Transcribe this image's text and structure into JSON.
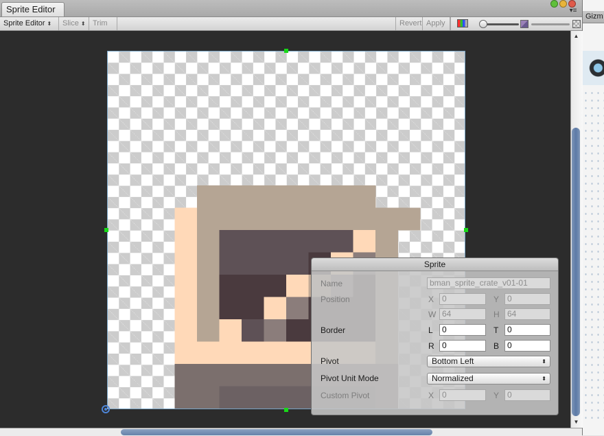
{
  "window": {
    "tab_title": "Sprite Editor",
    "buttons": [
      "close",
      "minimize",
      "zoom"
    ]
  },
  "right_panel": {
    "tab_label": "Gizm"
  },
  "toolbar": {
    "editor_dropdown": "Sprite Editor",
    "slice": "Slice",
    "trim": "Trim",
    "revert": "Revert",
    "apply": "Apply",
    "color_icon": "rgb-channel-icon",
    "zoom_level": 0.2
  },
  "colors": {
    "handle": "#18d818",
    "pivot": "#4e86d8",
    "viewport_bg": "#2c2c2c",
    "scroll_thumb": "#5c7aa6"
  },
  "sprite_image": {
    "grid": 16,
    "palette": {
      "A": "#ffd9b8",
      "B": "#b5a594",
      "C": "#9c8e81",
      "D": "#7b6f6d",
      "E": "#5e5156",
      "F": "#4a3a3e",
      "G": "#8b7d7b",
      "H": "#c1aa96",
      "I": "#a39083",
      "J": "#6c6163"
    },
    "rows": [
      "................",
      "................",
      "................",
      "................",
      "................",
      "..........",
      "....BBBBBBBB....",
      "...ABBBBBBBBBB..",
      "...ABEEEEEEAB...",
      "...ABEEEEFAGB...",
      "...ABFFFAHGFB...",
      "...ABFFAGFFFB...",
      "...ABAEGFFFFB...",
      "...AAAAAAAAAB...",
      "...DDDDDDDDDD...",
      "...DDJJJJJJJD..."
    ]
  },
  "sprite_panel": {
    "title": "Sprite",
    "name_label": "Name",
    "name_value": "bman_sprite_crate_v01-01",
    "position_label": "Position",
    "x_label": "X",
    "x_value": "0",
    "y_label": "Y",
    "y_value": "0",
    "w_label": "W",
    "w_value": "64",
    "h_label": "H",
    "h_value": "64",
    "border_label": "Border",
    "l_label": "L",
    "l_value": "0",
    "t_label": "T",
    "t_value": "0",
    "r_label": "R",
    "r_value": "0",
    "b_label": "B",
    "b_value": "0",
    "pivot_label": "Pivot",
    "pivot_value": "Bottom Left",
    "pivot_unit_label": "Pivot Unit Mode",
    "pivot_unit_value": "Normalized",
    "custom_pivot_label": "Custom Pivot",
    "cx_label": "X",
    "cx_value": "0",
    "cy_label": "Y",
    "cy_value": "0"
  }
}
